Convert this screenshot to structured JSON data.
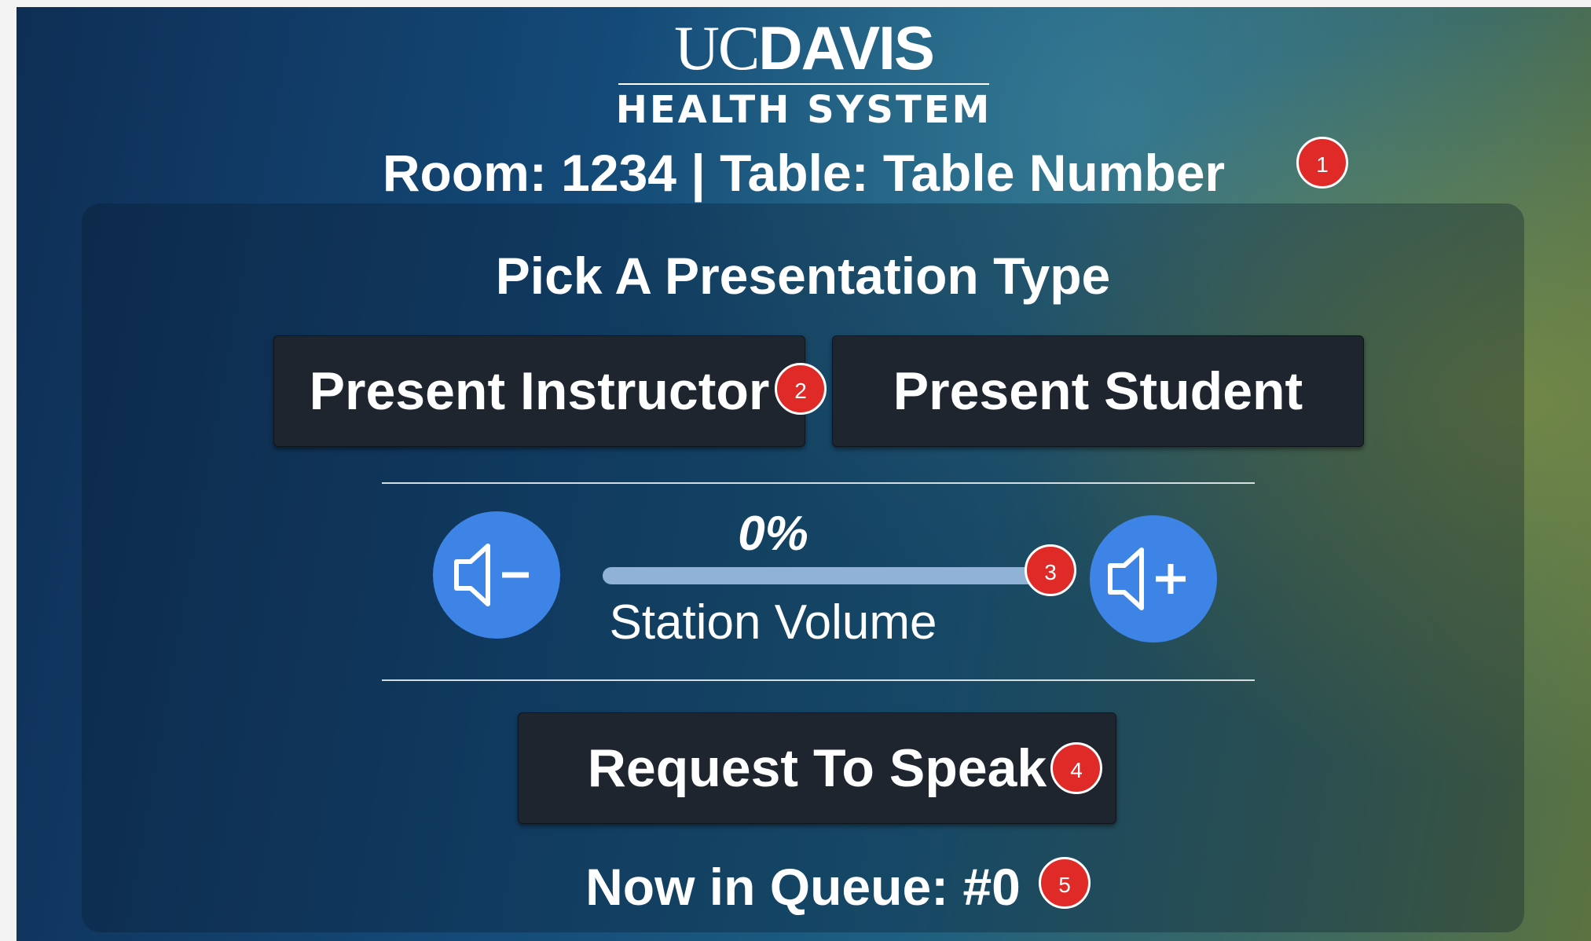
{
  "logo": {
    "brand_uc": "UC",
    "brand_davis": "DAVIS",
    "subtitle": "HEALTH SYSTEM"
  },
  "header": {
    "room_line": "Room: 1234 | Table: Table Number"
  },
  "panel": {
    "title": "Pick A Presentation Type",
    "present_instructor_label": "Present Instructor",
    "present_student_label": "Present Student"
  },
  "volume": {
    "percent_text": "0%",
    "level_percent": 0,
    "label": "Station Volume",
    "down_icon": "volume-down-icon",
    "up_icon": "volume-up-icon"
  },
  "speak": {
    "label": "Request To Speak"
  },
  "queue": {
    "text": "Now in Queue: #0"
  },
  "badges": [
    "1",
    "2",
    "3",
    "4",
    "5"
  ],
  "colors": {
    "button_bg": "#1f252e",
    "volume_button": "#3d84e6",
    "badge": "#e02a28",
    "track": "#8fb2d6"
  }
}
